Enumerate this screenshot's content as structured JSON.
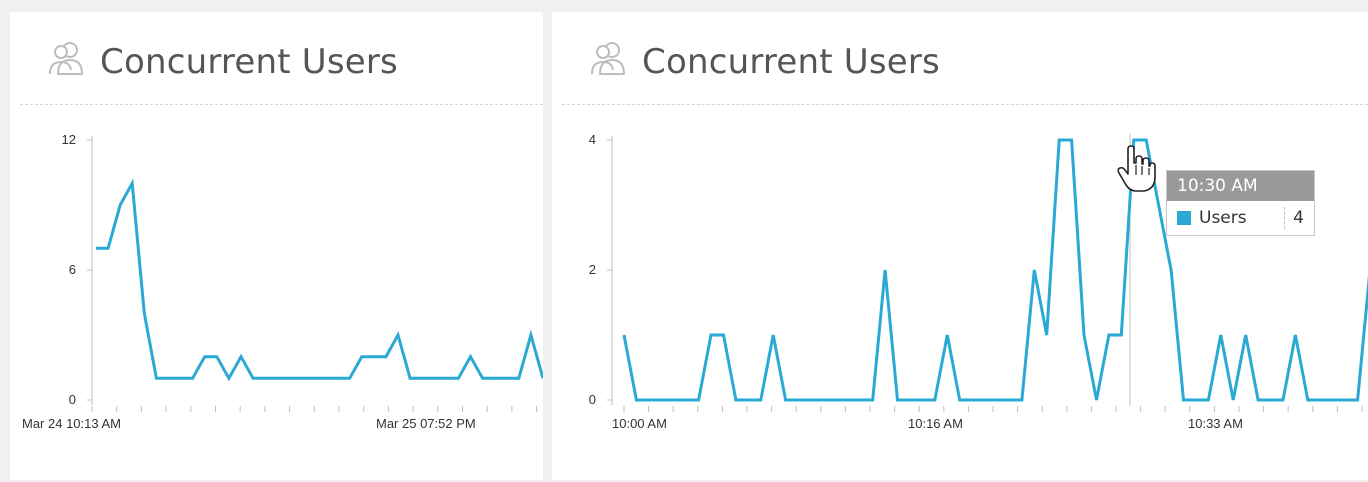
{
  "colors": {
    "series": "#29a9d4",
    "tooltip_header": "#9a9a9a"
  },
  "panels": [
    {
      "title": "Concurrent Users",
      "icon": "users-icon"
    },
    {
      "title": "Concurrent Users",
      "icon": "users-icon"
    }
  ],
  "tooltip": {
    "time": "10:30 AM",
    "series": "Users",
    "value": "4"
  },
  "chart_data": [
    {
      "type": "line",
      "title": "Concurrent Users",
      "ylim": [
        0,
        12
      ],
      "yticks": [
        0,
        6,
        12
      ],
      "xtick_labels": [
        "Mar 24 10:13 AM",
        "Mar 25 07:52 PM"
      ],
      "series": [
        {
          "values": [
            7,
            7,
            9,
            10,
            4,
            1,
            1,
            1,
            1,
            2,
            2,
            1,
            2,
            1,
            1,
            1,
            1,
            1,
            1,
            1,
            1,
            1,
            2,
            2,
            2,
            3,
            1,
            1,
            1,
            1,
            1,
            2,
            1,
            1,
            1,
            1,
            3,
            1
          ]
        }
      ]
    },
    {
      "type": "line",
      "title": "Concurrent Users",
      "ylim": [
        0,
        4
      ],
      "yticks": [
        0,
        2,
        4
      ],
      "xtick_labels": [
        "10:00 AM",
        "10:16 AM",
        "10:33 AM"
      ],
      "series": [
        {
          "name": "Users",
          "values": [
            1,
            0,
            0,
            0,
            0,
            0,
            0,
            1,
            1,
            0,
            0,
            0,
            1,
            0,
            0,
            0,
            0,
            0,
            0,
            0,
            0,
            2,
            0,
            0,
            0,
            0,
            1,
            0,
            0,
            0,
            0,
            0,
            0,
            2,
            1,
            4,
            4,
            1,
            0,
            1,
            1,
            4,
            4,
            3,
            2,
            0,
            0,
            0,
            1,
            0,
            1,
            0,
            0,
            0,
            1,
            0,
            0,
            0,
            0,
            0,
            2
          ]
        }
      ]
    }
  ]
}
